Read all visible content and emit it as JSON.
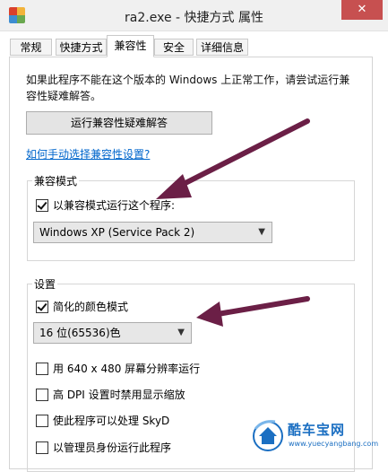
{
  "window": {
    "title": "ra2.exe - 快捷方式 属性",
    "close_glyph": "✕"
  },
  "tabs": [
    {
      "label": "常规"
    },
    {
      "label": "快捷方式"
    },
    {
      "label": "兼容性",
      "active": true
    },
    {
      "label": "安全"
    },
    {
      "label": "详细信息"
    }
  ],
  "compat": {
    "intro": "如果此程序不能在这个版本的 Windows 上正常工作，请尝试运行兼容性疑难解答。",
    "troubleshoot_button": "运行兼容性疑难解答",
    "manual_link": "如何手动选择兼容性设置?",
    "mode_group_title": "兼容模式",
    "run_in_compat_label": "以兼容模式运行这个程序:",
    "run_in_compat_checked": true,
    "os_select_value": "Windows XP (Service Pack 2)"
  },
  "settings": {
    "group_title": "设置",
    "reduced_color_label": "简化的颜色模式",
    "reduced_color_checked": true,
    "color_select_value": "16 位(65536)色",
    "run_640_label": "用 640 x 480 屏幕分辨率运行",
    "run_640_checked": false,
    "high_dpi_label": "高 DPI 设置时禁用显示缩放",
    "high_dpi_checked": false,
    "skydrive_label": "使此程序可以处理 SkyD",
    "skydrive_checked": false,
    "admin_label": "以管理员身份运行此程序",
    "admin_checked": false
  },
  "watermark": {
    "brand": "酷车宝网",
    "url": "www.yuecyangbang.com"
  },
  "colors": {
    "arrow": "#6b1f46",
    "accent_link": "#0066cc"
  },
  "icons": {
    "app": "app-icon",
    "close": "close-icon",
    "dropdown": "chevron-down-icon",
    "checkbox": "checkmark-icon",
    "arrow": "arrow-annotation"
  }
}
